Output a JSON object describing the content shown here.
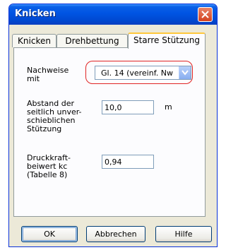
{
  "window": {
    "title": "Knicken"
  },
  "tabs": [
    {
      "label": "Knicken"
    },
    {
      "label": "Drehbettung"
    },
    {
      "label": "Starre Stützung"
    }
  ],
  "form": {
    "nachweise_label_line1": "Nachweise",
    "nachweise_label_line2": "mit",
    "nachweise_value": "Gl. 14 (vereinf. Nw",
    "abstand_label_lines": [
      "Abstand der",
      "seitlich unver-",
      "schieblichen",
      "Stützung"
    ],
    "abstand_value": "10,0",
    "abstand_unit": "m",
    "druck_label_lines": [
      "Druckkraft-",
      "beiwert kc",
      "(Tabelle 8)"
    ],
    "druck_value": "0,94"
  },
  "buttons": {
    "ok": "OK",
    "cancel": "Abbrechen",
    "help": "Hilfe"
  },
  "icons": {
    "close": "close-icon",
    "dropdown": "chevron-down-icon"
  }
}
